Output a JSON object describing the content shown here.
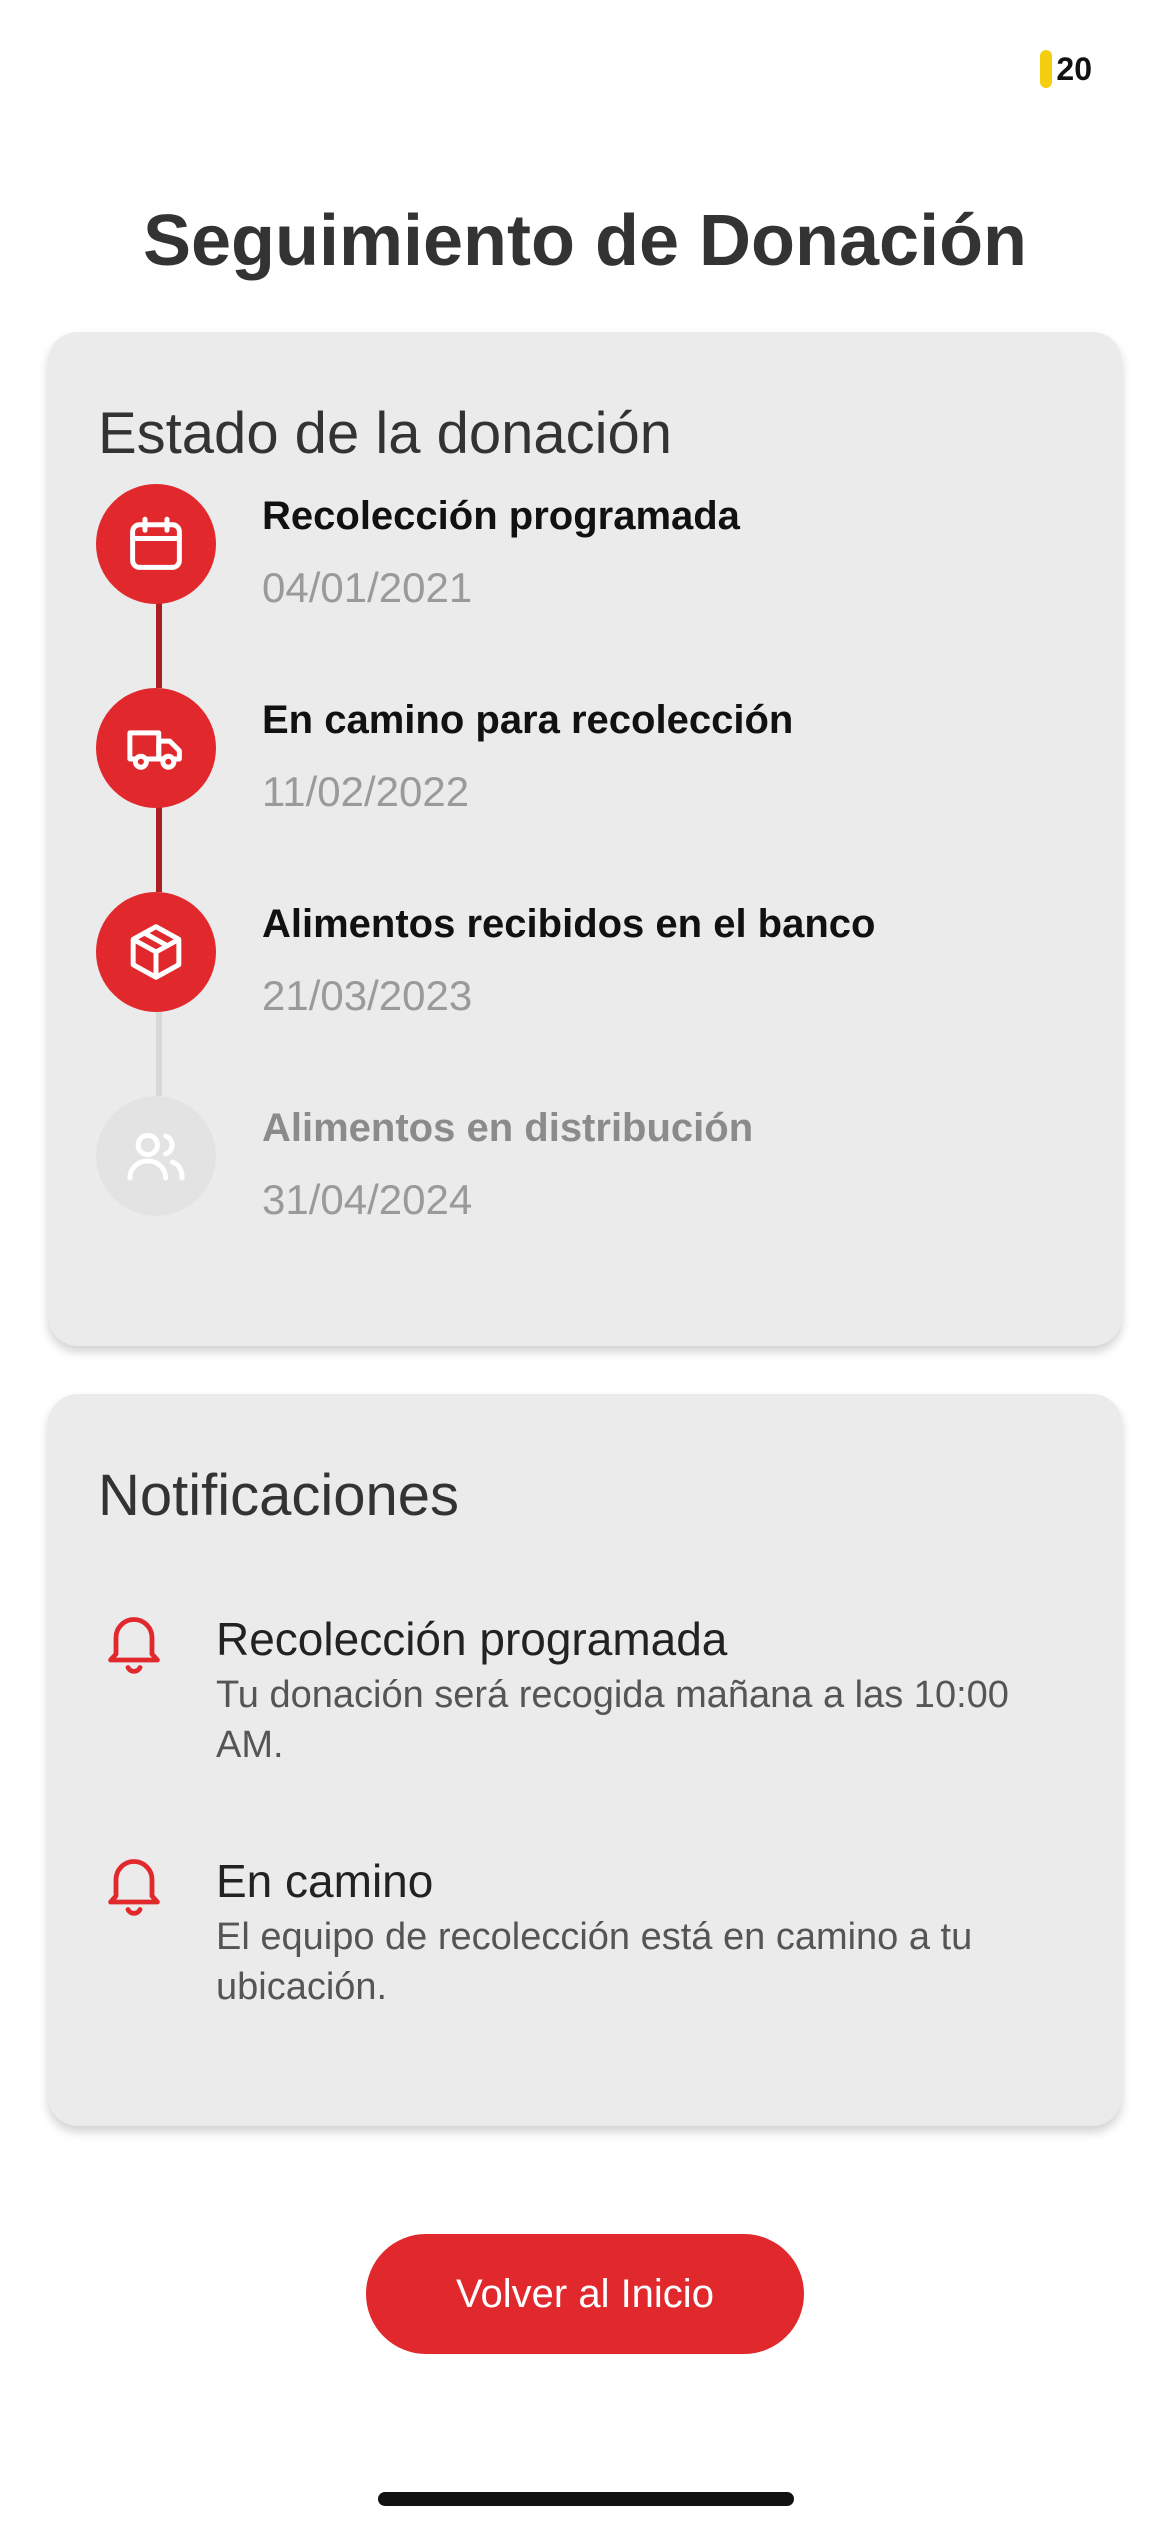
{
  "status_bar": {
    "battery_level": "20"
  },
  "page_title": "Seguimiento de Donación",
  "status_card": {
    "title": "Estado de la donación",
    "steps": [
      {
        "label": "Recolección programada",
        "date": "04/01/2021",
        "icon": "calendar-icon",
        "state": "done"
      },
      {
        "label": "En camino para recolección",
        "date": "11/02/2022",
        "icon": "truck-icon",
        "state": "done"
      },
      {
        "label": "Alimentos recibidos en el banco",
        "date": "21/03/2023",
        "icon": "package-icon",
        "state": "done"
      },
      {
        "label": "Alimentos en distribución",
        "date": "31/04/2024",
        "icon": "users-icon",
        "state": "pending"
      }
    ]
  },
  "notifications_card": {
    "title": "Notificaciones",
    "items": [
      {
        "title": "Recolección programada",
        "body": "Tu donación será recogida mañana a las 10:00 AM.",
        "icon": "bell-icon"
      },
      {
        "title": "En camino",
        "body": "El equipo de recolección está en camino a tu ubicación.",
        "icon": "bell-icon"
      }
    ]
  },
  "home_button_label": "Volver al Inicio",
  "colors": {
    "accent": "#e1292d",
    "card_bg": "#ebebeb",
    "inactive": "#e3e3e3",
    "battery": "#f5cf0d"
  }
}
